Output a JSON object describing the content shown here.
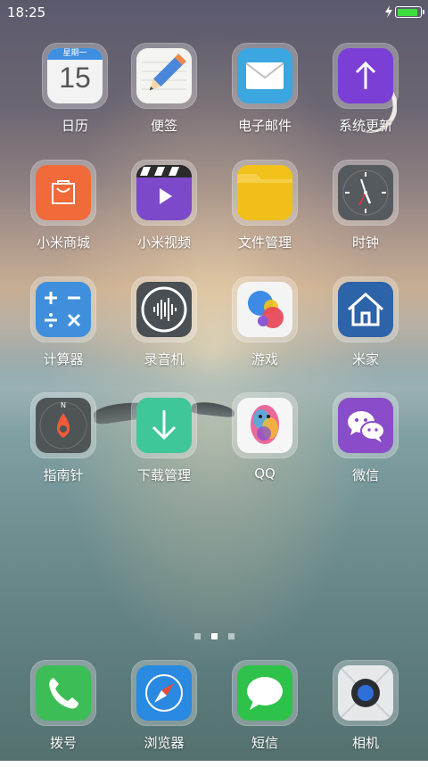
{
  "status": {
    "time": "18:25",
    "battery_level": 0.95,
    "charging": true
  },
  "apps": [
    {
      "id": "calendar",
      "label": "日历",
      "weekday": "星期一",
      "date": "15"
    },
    {
      "id": "notes",
      "label": "便签"
    },
    {
      "id": "email",
      "label": "电子邮件"
    },
    {
      "id": "updater",
      "label": "系统更新"
    },
    {
      "id": "mall",
      "label": "小米商城"
    },
    {
      "id": "video",
      "label": "小米视频"
    },
    {
      "id": "files",
      "label": "文件管理"
    },
    {
      "id": "clock",
      "label": "时钟"
    },
    {
      "id": "calculator",
      "label": "计算器"
    },
    {
      "id": "recorder",
      "label": "录音机"
    },
    {
      "id": "games",
      "label": "游戏"
    },
    {
      "id": "mihome",
      "label": "米家"
    },
    {
      "id": "compass",
      "label": "指南针"
    },
    {
      "id": "downloads",
      "label": "下载管理"
    },
    {
      "id": "qq",
      "label": "QQ"
    },
    {
      "id": "wechat",
      "label": "微信"
    }
  ],
  "dock": [
    {
      "id": "phone",
      "label": "拨号"
    },
    {
      "id": "browser",
      "label": "浏览器"
    },
    {
      "id": "messages",
      "label": "短信"
    },
    {
      "id": "camera",
      "label": "相机"
    }
  ],
  "pager": {
    "pages": 3,
    "current": 2
  },
  "colors": {
    "battery": "#3fdc3f",
    "mall": "#f06a3a",
    "video": "#7b49c9",
    "files": "#f2c21b",
    "updater": "#7b3fd6",
    "calculator": "#3f8fdc",
    "wechat": "#8a4cc8",
    "downloads": "#3fc79a",
    "phone": "#3dbd56",
    "browser": "#2a89e0",
    "messages": "#2ec24a"
  }
}
